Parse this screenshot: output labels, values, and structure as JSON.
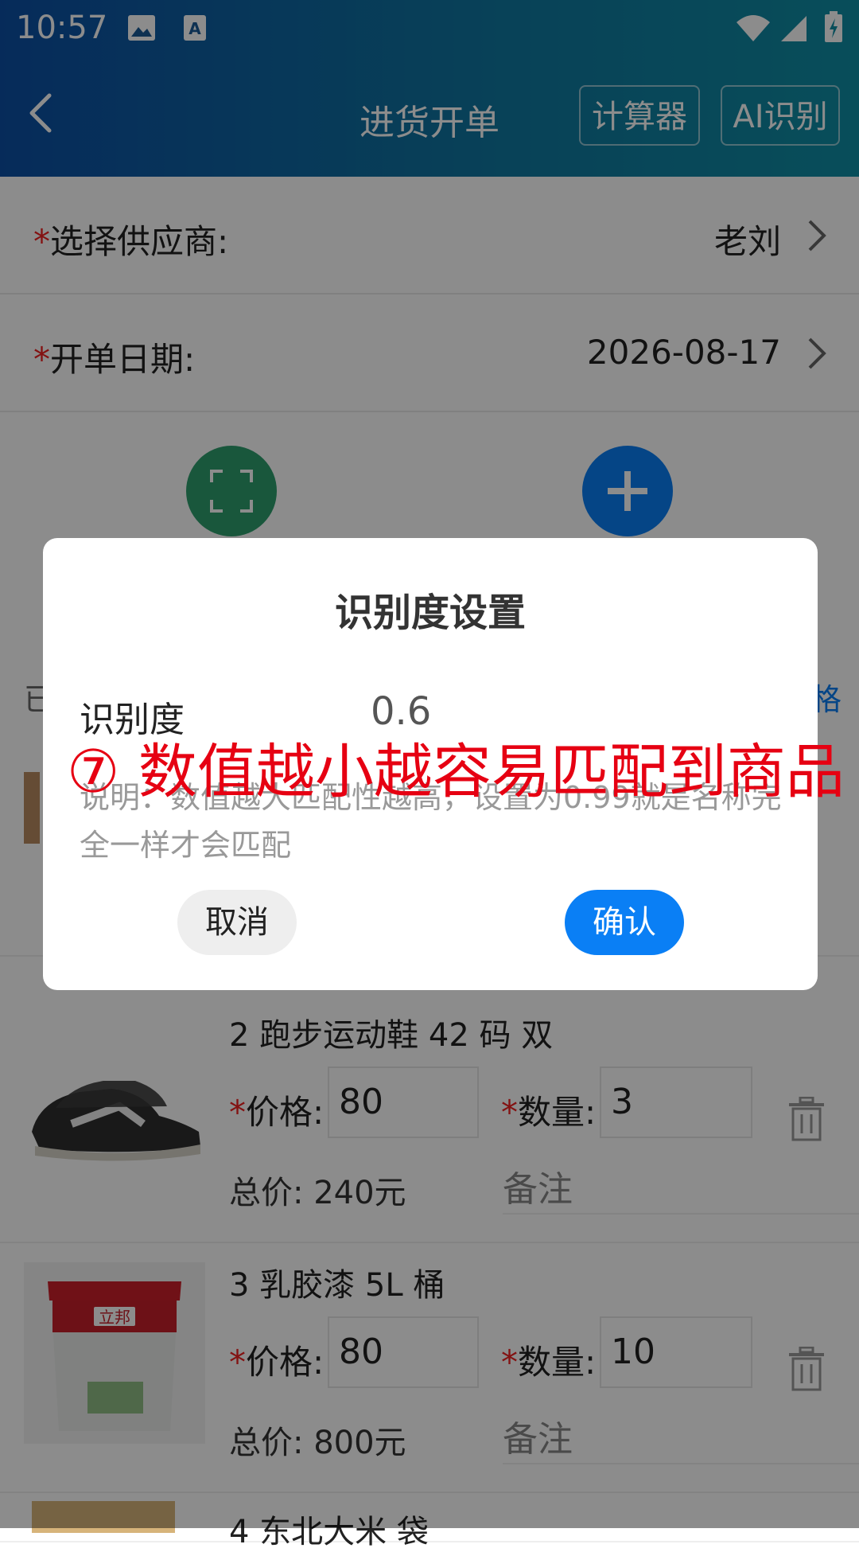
{
  "status_bar": {
    "time": "10:57"
  },
  "header": {
    "title": "进货开单",
    "calculator_label": "计算器",
    "ai_label": "AI识别"
  },
  "form": {
    "supplier": {
      "label": "选择供应商:",
      "value": "老刘"
    },
    "date": {
      "label": "开单日期:",
      "value": "2026-08-17"
    }
  },
  "list": {
    "head_left": "已",
    "head_right": "格",
    "items": [
      {
        "name": "2 跑步运动鞋 42 码 双",
        "price_label": "价格:",
        "price": "80",
        "qty_label": "数量:",
        "qty": "3",
        "total": "总价: 240元",
        "note_placeholder": "备注",
        "image_icon": "sneaker"
      },
      {
        "name": "3 乳胶漆 5L 桶",
        "price_label": "价格:",
        "price": "80",
        "qty_label": "数量:",
        "qty": "10",
        "total": "总价: 800元",
        "note_placeholder": "备注",
        "image_icon": "paint-bucket",
        "brand": "立邦"
      },
      {
        "name": "4 东北大米 袋"
      }
    ]
  },
  "dialog": {
    "title": "识别度设置",
    "field_label": "识别度",
    "field_value": "0.6",
    "description": "说明：数值越大匹配性越高，设置为0.99就是名称完全一样才会匹配",
    "cancel_label": "取消",
    "confirm_label": "确认"
  },
  "annotation": "⑦ 数值越小越容易匹配到商品",
  "colors": {
    "primary": "#0a7ff5",
    "header_start": "#0c4fa5",
    "header_end": "#0f8ea4",
    "scan_green": "#2e9e6e",
    "annotation_red": "#e60012"
  }
}
